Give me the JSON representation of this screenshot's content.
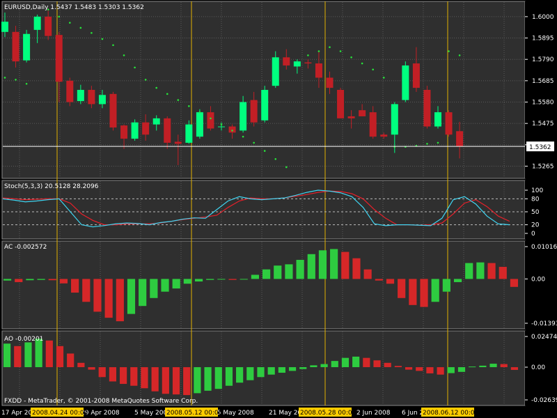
{
  "colors": {
    "background": "#000000",
    "pane": "#2f2f2f",
    "grid": "#5a5a5a",
    "bull": "#00ff7f",
    "bear": "#c21f25",
    "acUp": "#2ecc40",
    "acDown": "#d62728",
    "sar": "#27e33a",
    "stochMain": "#3fd5f2",
    "stochSignal": "#e8202a",
    "vline": "#e0b000",
    "text": "#ffffff",
    "marker": "#ffcc00"
  },
  "chart_data": [
    {
      "type": "candlestick",
      "title": "EURUSD,Daily  1.5437 1.5483 1.5303 1.5362",
      "ylim": [
        1.5205,
        1.6075
      ],
      "yticks": [
        "1.6000",
        "1.5895",
        "1.5790",
        "1.5685",
        "1.5580",
        "1.5475",
        "1.5370",
        "1.5265"
      ],
      "current_price": "1.5362",
      "candles": [
        {
          "o": 1.5925,
          "h": 1.602,
          "l": 1.59,
          "c": 1.5975
        },
        {
          "o": 1.5925,
          "h": 1.5955,
          "l": 1.575,
          "c": 1.578
        },
        {
          "o": 1.5785,
          "h": 1.5935,
          "l": 1.5775,
          "c": 1.5915
        },
        {
          "o": 1.5935,
          "h": 1.601,
          "l": 1.587,
          "c": 1.6
        },
        {
          "o": 1.6,
          "h": 1.603,
          "l": 1.5885,
          "c": 1.5905
        },
        {
          "o": 1.591,
          "h": 1.5925,
          "l": 1.558,
          "c": 1.568
        },
        {
          "o": 1.5685,
          "h": 1.57,
          "l": 1.556,
          "c": 1.558
        },
        {
          "o": 1.5585,
          "h": 1.5665,
          "l": 1.557,
          "c": 1.564
        },
        {
          "o": 1.564,
          "h": 1.566,
          "l": 1.555,
          "c": 1.557
        },
        {
          "o": 1.557,
          "h": 1.564,
          "l": 1.555,
          "c": 1.5615
        },
        {
          "o": 1.562,
          "h": 1.563,
          "l": 1.544,
          "c": 1.5455
        },
        {
          "o": 1.5465,
          "h": 1.547,
          "l": 1.535,
          "c": 1.54
        },
        {
          "o": 1.54,
          "h": 1.5495,
          "l": 1.539,
          "c": 1.548
        },
        {
          "o": 1.548,
          "h": 1.552,
          "l": 1.539,
          "c": 1.542
        },
        {
          "o": 1.547,
          "h": 1.5515,
          "l": 1.544,
          "c": 1.55
        },
        {
          "o": 1.55,
          "h": 1.551,
          "l": 1.535,
          "c": 1.538
        },
        {
          "o": 1.5385,
          "h": 1.542,
          "l": 1.527,
          "c": 1.5375
        },
        {
          "o": 1.538,
          "h": 1.549,
          "l": 1.5375,
          "c": 1.547
        },
        {
          "o": 1.541,
          "h": 1.5545,
          "l": 1.54,
          "c": 1.553
        },
        {
          "o": 1.553,
          "h": 1.556,
          "l": 1.544,
          "c": 1.545
        },
        {
          "o": 1.546,
          "h": 1.548,
          "l": 1.544,
          "c": 1.546
        },
        {
          "o": 1.546,
          "h": 1.547,
          "l": 1.54,
          "c": 1.543
        },
        {
          "o": 1.544,
          "h": 1.561,
          "l": 1.543,
          "c": 1.558
        },
        {
          "o": 1.559,
          "h": 1.563,
          "l": 1.546,
          "c": 1.548
        },
        {
          "o": 1.549,
          "h": 1.566,
          "l": 1.548,
          "c": 1.564
        },
        {
          "o": 1.566,
          "h": 1.583,
          "l": 1.565,
          "c": 1.58
        },
        {
          "o": 1.58,
          "h": 1.584,
          "l": 1.574,
          "c": 1.576
        },
        {
          "o": 1.5755,
          "h": 1.579,
          "l": 1.572,
          "c": 1.578
        },
        {
          "o": 1.5775,
          "h": 1.579,
          "l": 1.5745,
          "c": 1.577
        },
        {
          "o": 1.577,
          "h": 1.583,
          "l": 1.565,
          "c": 1.57
        },
        {
          "o": 1.57,
          "h": 1.573,
          "l": 1.562,
          "c": 1.565
        },
        {
          "o": 1.564,
          "h": 1.565,
          "l": 1.552,
          "c": 1.55
        },
        {
          "o": 1.551,
          "h": 1.554,
          "l": 1.545,
          "c": 1.55
        },
        {
          "o": 1.554,
          "h": 1.557,
          "l": 1.551,
          "c": 1.551
        },
        {
          "o": 1.553,
          "h": 1.556,
          "l": 1.54,
          "c": 1.541
        },
        {
          "o": 1.542,
          "h": 1.543,
          "l": 1.54,
          "c": 1.541
        },
        {
          "o": 1.542,
          "h": 1.558,
          "l": 1.533,
          "c": 1.557
        },
        {
          "o": 1.559,
          "h": 1.578,
          "l": 1.558,
          "c": 1.576
        },
        {
          "o": 1.577,
          "h": 1.585,
          "l": 1.563,
          "c": 1.565
        },
        {
          "o": 1.564,
          "h": 1.566,
          "l": 1.545,
          "c": 1.546
        },
        {
          "o": 1.546,
          "h": 1.556,
          "l": 1.545,
          "c": 1.553
        },
        {
          "o": 1.553,
          "h": 1.554,
          "l": 1.541,
          "c": 1.542
        },
        {
          "o": 1.5437,
          "h": 1.5483,
          "l": 1.5303,
          "c": 1.5362
        }
      ],
      "sar": [
        1.57,
        1.569,
        1.567,
        null,
        1.6035,
        1.6,
        1.597,
        1.5945,
        1.592,
        1.589,
        1.586,
        1.581,
        1.575,
        1.569,
        1.565,
        1.562,
        1.559,
        1.556,
        1.553,
        1.55,
        1.547,
        1.544,
        1.541,
        1.538,
        1.534,
        1.53,
        1.526,
        null,
        1.581,
        1.583,
        1.585,
        1.583,
        1.58,
        1.577,
        1.574,
        1.57,
        1.536,
        1.536,
        1.5365,
        1.5375,
        1.538,
        1.583,
        1.581
      ]
    },
    {
      "type": "line",
      "title": "Stoch(5,3,3) 20.5128 28.2096",
      "ylim": [
        0,
        100
      ],
      "yticks": [
        "100",
        "80",
        "50",
        "20",
        "0"
      ],
      "levels": [
        80,
        50,
        20
      ],
      "series": [
        {
          "values": [
            80,
            77,
            73,
            75,
            78,
            80,
            50,
            20,
            15,
            18,
            22,
            24,
            23,
            20,
            25,
            28,
            33,
            36,
            35,
            55,
            75,
            85,
            80,
            78,
            80,
            82,
            88,
            95,
            100,
            98,
            94,
            85,
            60,
            22,
            18,
            20,
            20,
            19,
            18,
            35,
            78,
            85,
            68,
            40,
            22,
            20
          ]
        },
        {
          "values": [
            82,
            80,
            78,
            79,
            80,
            80,
            70,
            45,
            30,
            20,
            20,
            22,
            22,
            22,
            24,
            28,
            32,
            35,
            38,
            42,
            60,
            75,
            82,
            80,
            80,
            82,
            86,
            90,
            95,
            98,
            97,
            92,
            80,
            55,
            35,
            20,
            20,
            19,
            20,
            24,
            45,
            70,
            78,
            62,
            40,
            28
          ]
        }
      ]
    },
    {
      "type": "bar",
      "title": "AC -0.002572",
      "ylim": [
        -0.01393,
        0.01016
      ],
      "yticks": [
        "0.01016",
        "0.00",
        "-0.01393"
      ],
      "values": [
        -0.0005,
        -0.001,
        -0.0004,
        -0.0003,
        -0.0004,
        -0.0014,
        -0.0043,
        -0.0072,
        -0.0103,
        -0.0122,
        -0.0133,
        -0.011,
        -0.0085,
        -0.006,
        -0.004,
        -0.003,
        -0.0015,
        -0.0008,
        -0.0003,
        -0.0002,
        -0.0003,
        -0.0001,
        0.0013,
        0.003,
        0.0042,
        0.0046,
        0.006,
        0.0078,
        0.009,
        0.0094,
        0.0085,
        0.0065,
        0.003,
        -0.0005,
        -0.0015,
        -0.006,
        -0.0082,
        -0.0088,
        -0.0072,
        -0.004,
        -0.001,
        0.005,
        0.0052,
        0.005,
        0.0038,
        -0.0025
      ]
    },
    {
      "type": "bar",
      "title": "AO -0.00201",
      "ylim": [
        -0.02639,
        0.02474
      ],
      "yticks": [
        "0.02474",
        "0.00",
        "-0.02639"
      ],
      "values": [
        0.019,
        0.017,
        0.02,
        0.023,
        0.0215,
        0.017,
        0.011,
        0.0035,
        -0.002,
        -0.008,
        -0.0115,
        -0.0135,
        -0.015,
        -0.017,
        -0.0195,
        -0.0215,
        -0.022,
        -0.0225,
        -0.021,
        -0.019,
        -0.0175,
        -0.015,
        -0.0125,
        -0.0105,
        -0.008,
        -0.006,
        -0.0045,
        -0.003,
        -0.0015,
        0.0015,
        0.0025,
        0.005,
        0.0075,
        0.0085,
        0.0075,
        0.0055,
        0.0035,
        0.001,
        -0.002,
        -0.003,
        -0.005,
        -0.006,
        -0.0048,
        -0.0038,
        0.0005,
        0.0012,
        0.0028,
        0.0025,
        -0.0022
      ]
    }
  ],
  "xaxis": {
    "labels": [
      "17 Apr 2008",
      "29 Apr 2008",
      "5 May 2008",
      "15 May 2008",
      "21 May 2008",
      "2 Jun 2008",
      "6 Jun 2008"
    ],
    "markers": [
      "2008.04.24 00:00",
      "2008.05.12 00:00",
      "2008.05.28 00:00",
      "2008.06.12 00:00"
    ]
  },
  "footer": "FXDD - MetaTrader, © 2001-2008 MetaQuotes Software Corp."
}
